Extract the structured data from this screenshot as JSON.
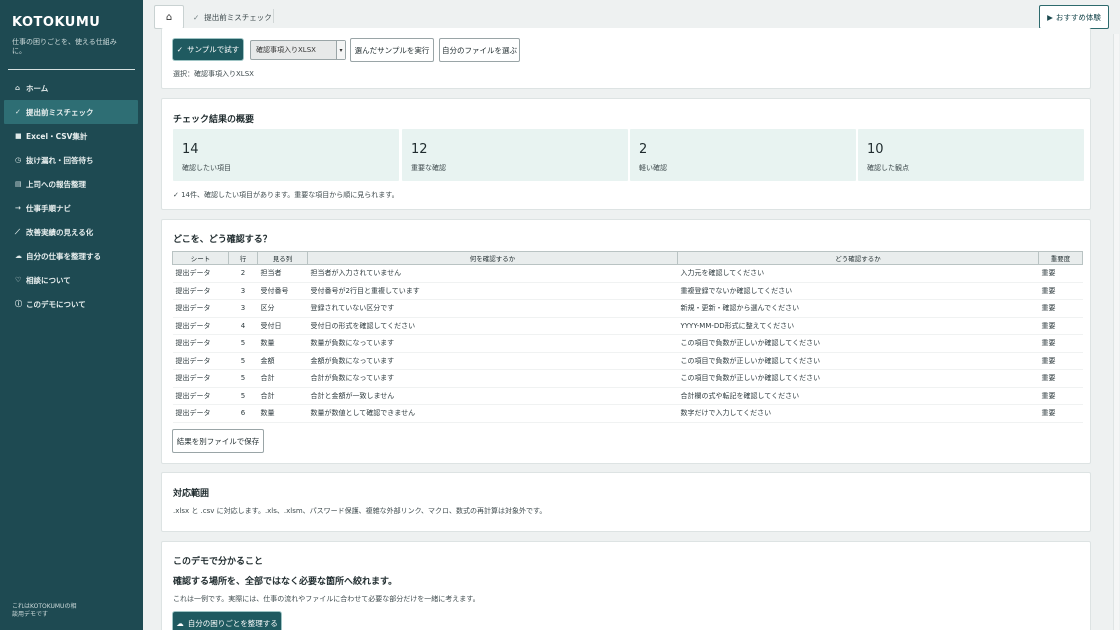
{
  "sidebar": {
    "brand": "KOTOKUMU",
    "tagline": "仕事の困りごとを、使える仕組みに。",
    "items": [
      {
        "icon": "⌂",
        "label": "ホーム"
      },
      {
        "icon": "✓",
        "label": "提出前ミスチェック"
      },
      {
        "icon": "■",
        "label": "Excel・CSV集計"
      },
      {
        "icon": "◷",
        "label": "抜け漏れ・回答待ち"
      },
      {
        "icon": "▤",
        "label": "上司への報告整理"
      },
      {
        "icon": "→",
        "label": "仕事手順ナビ"
      },
      {
        "icon": "⟋",
        "label": "改善実績の見える化"
      },
      {
        "icon": "☁",
        "label": "自分の仕事を整理する"
      },
      {
        "icon": "♡",
        "label": "相談について"
      },
      {
        "icon": "ⓘ",
        "label": "このデモについて"
      }
    ],
    "footer": "これはKOTOKUMUの相談用デモです"
  },
  "topbar": {
    "home_icon": "⌂",
    "breadcrumb_check": "✓",
    "breadcrumb": "提出前ミスチェック",
    "try_icon": "▶",
    "try_label": "おすすめ体験"
  },
  "sample": {
    "run_sample_icon": "✓",
    "run_sample_label": "サンプルで試す",
    "select_value": "確認事項入りXLSX",
    "select_arrow": "▾",
    "run_selected_label": "選んだサンプルを実行",
    "choose_file_label": "自分のファイルを選ぶ",
    "selected_note": "選択：確認事項入りXLSX"
  },
  "summary": {
    "title": "チェック結果の概要",
    "stats": [
      {
        "num": "14",
        "label": "確認したい項目"
      },
      {
        "num": "12",
        "label": "重要な確認"
      },
      {
        "num": "2",
        "label": "軽い確認"
      },
      {
        "num": "10",
        "label": "確認した観点"
      }
    ],
    "note": "✓  14件、確認したい項目があります。重要な項目から順に見られます。"
  },
  "table_section": {
    "title": "どこを、どう確認する？",
    "headers": [
      "シート",
      "行",
      "見る列",
      "何を確認するか",
      "どう確認するか",
      "重要度"
    ],
    "rows": [
      [
        "提出データ",
        "2",
        "担当者",
        "担当者が入力されていません",
        "入力元を確認してください",
        "重要"
      ],
      [
        "提出データ",
        "3",
        "受付番号",
        "受付番号が2行目と重複しています",
        "重複登録でないか確認してください",
        "重要"
      ],
      [
        "提出データ",
        "3",
        "区分",
        "登録されていない区分です",
        "新規・更新・確認から選んでください",
        "重要"
      ],
      [
        "提出データ",
        "4",
        "受付日",
        "受付日の形式を確認してください",
        "YYYY-MM-DD形式に整えてください",
        "重要"
      ],
      [
        "提出データ",
        "5",
        "数量",
        "数量が負数になっています",
        "この項目で負数が正しいか確認してください",
        "重要"
      ],
      [
        "提出データ",
        "5",
        "金額",
        "金額が負数になっています",
        "この項目で負数が正しいか確認してください",
        "重要"
      ],
      [
        "提出データ",
        "5",
        "合計",
        "合計が負数になっています",
        "この項目で負数が正しいか確認してください",
        "重要"
      ],
      [
        "提出データ",
        "5",
        "合計",
        "合計と金額が一致しません",
        "合計欄の式や転記を確認してください",
        "重要"
      ],
      [
        "提出データ",
        "6",
        "数量",
        "数量が数値として確認できません",
        "数字だけで入力してください",
        "重要"
      ]
    ],
    "save_label": "結果を別ファイルで保存"
  },
  "scope": {
    "title": "対応範囲",
    "text": ".xlsx と .csv に対応します。.xls、.xlsm、パスワード保護、複雑な外部リンク、マクロ、数式の再計算は対象外です。"
  },
  "learn": {
    "title": "このデモで分かること",
    "subtitle": "確認する場所を、全部ではなく必要な箇所へ絞れます。",
    "text": "これは一例です。実際には、仕事の流れやファイルに合わせて必要な部分だけを一緒に考えます。",
    "button_icon": "☁",
    "button_label": "自分の困りごとを整理する"
  },
  "colors": {
    "sidebar_bg": "#1e4a52",
    "accent": "#1f5a60",
    "stat_bg": "#e8f3f1"
  }
}
